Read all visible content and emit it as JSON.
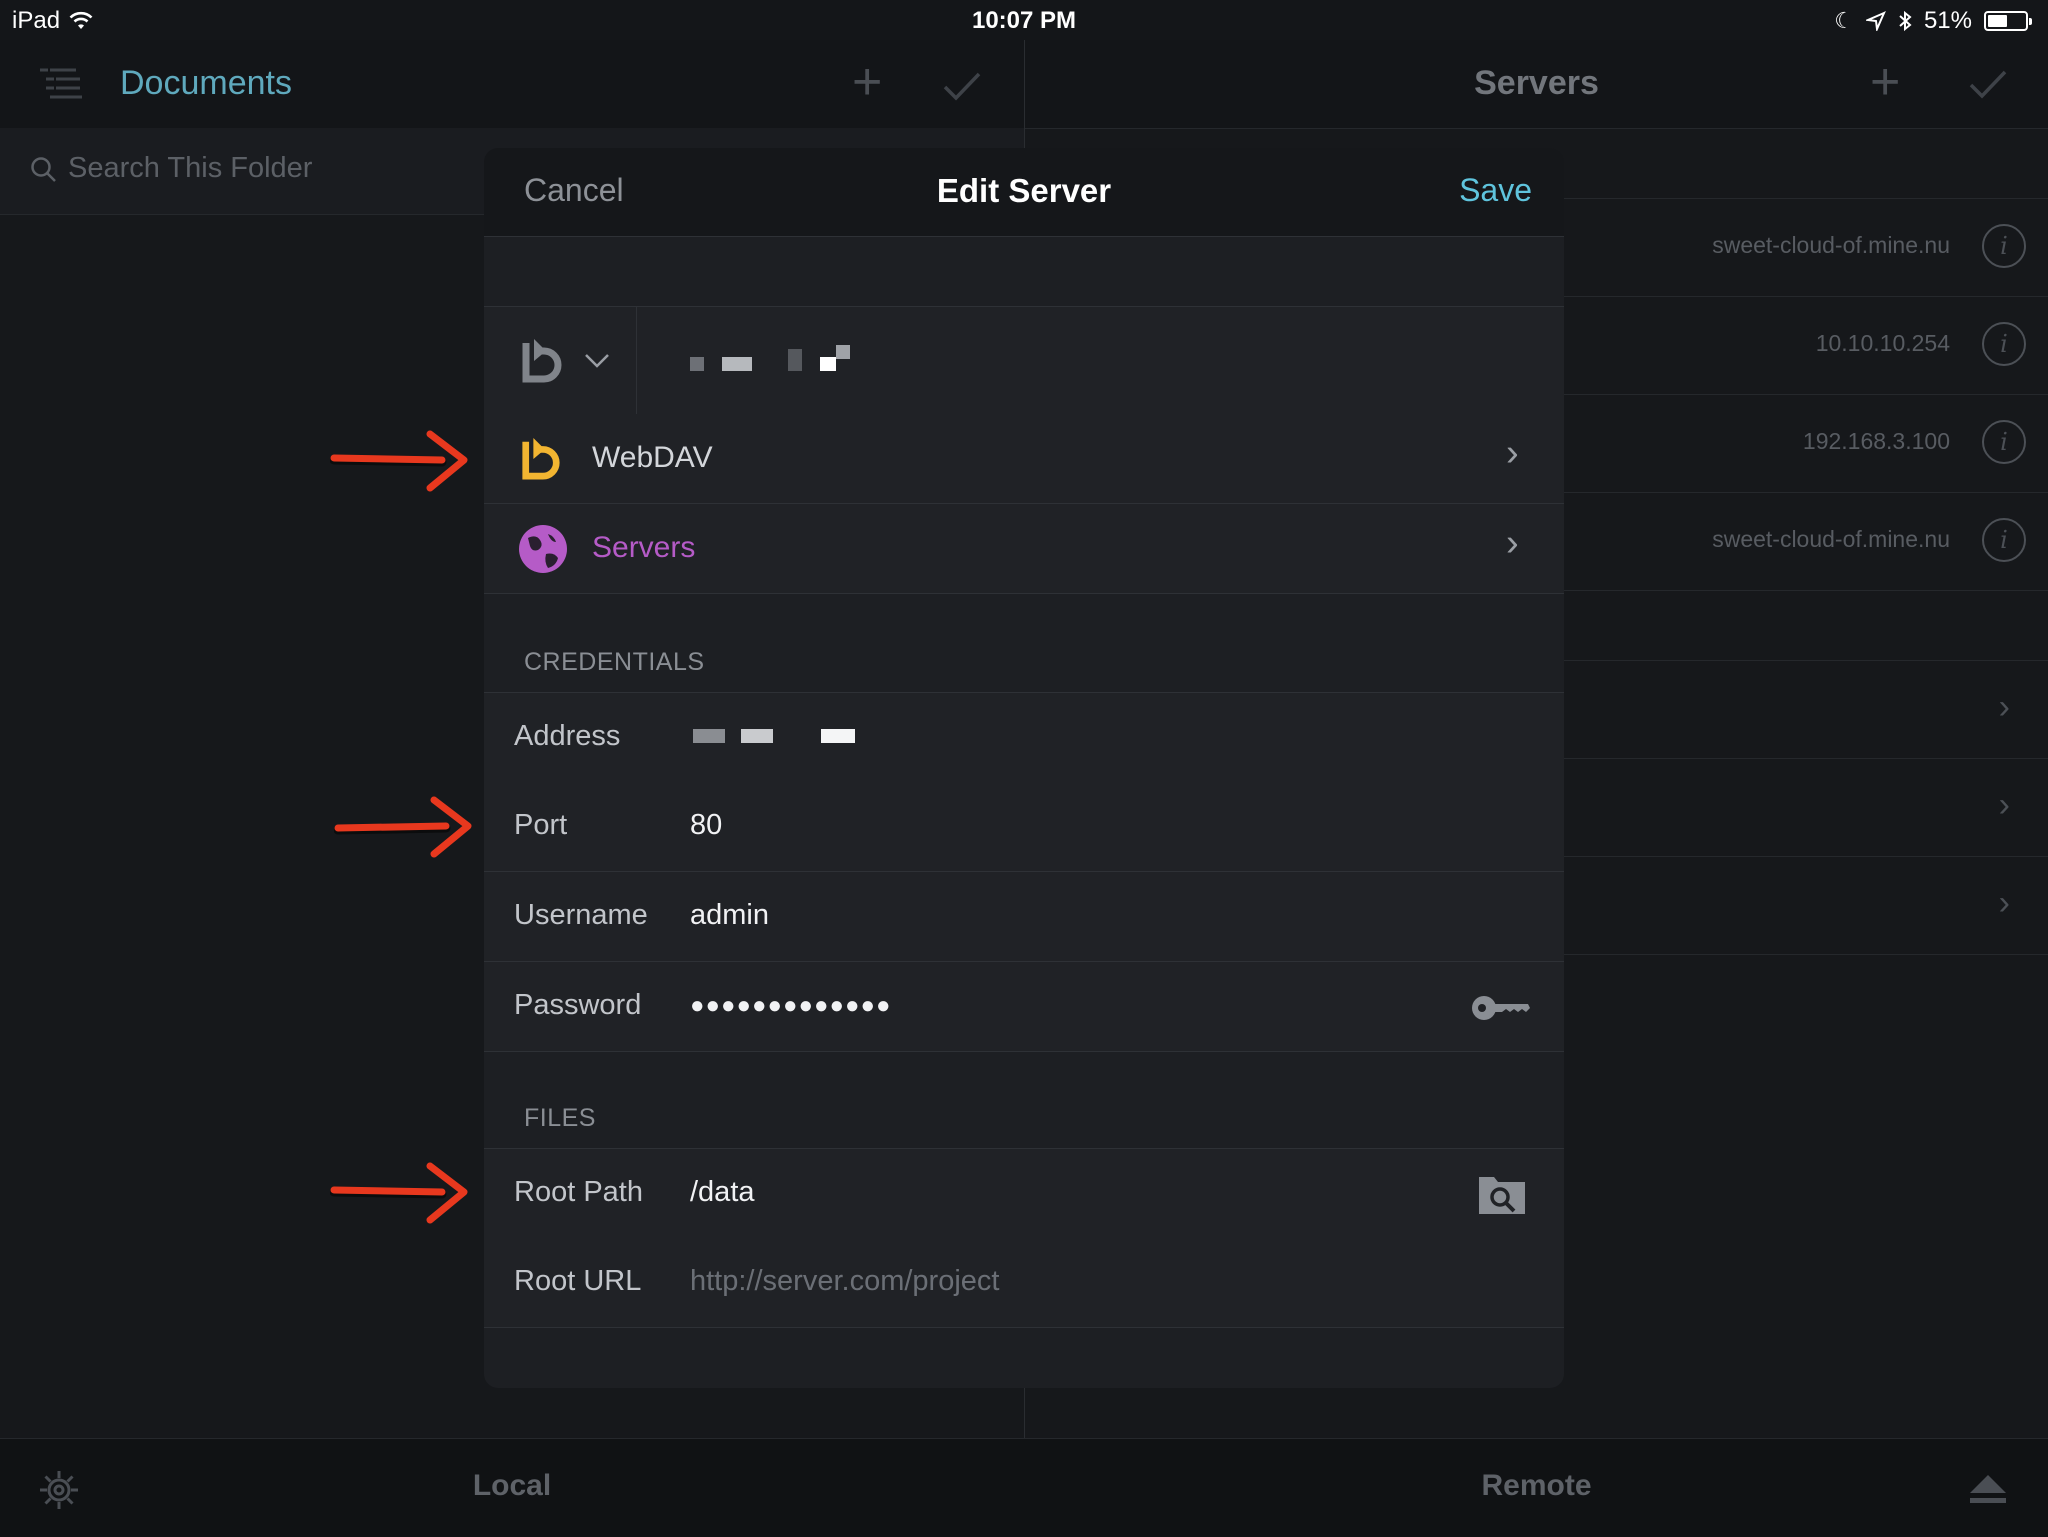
{
  "status_bar": {
    "device": "iPad",
    "time": "10:07 PM",
    "battery": "51%"
  },
  "left_pane": {
    "title": "Documents",
    "search_placeholder": "Search This Folder"
  },
  "right_pane": {
    "title": "Servers",
    "servers": [
      {
        "host": "sweet-cloud-of.mine.nu"
      },
      {
        "host": "10.10.10.254"
      },
      {
        "host": "192.168.3.100"
      },
      {
        "host": "sweet-cloud-of.mine.nu"
      }
    ]
  },
  "tab_bar": {
    "local_label": "Local",
    "remote_label": "Remote"
  },
  "modal": {
    "cancel_label": "Cancel",
    "title": "Edit Server",
    "save_label": "Save",
    "type_row": {
      "label": "WebDAV"
    },
    "group_row": {
      "label": "Servers"
    },
    "credentials_header": "CREDENTIALS",
    "address": {
      "label": "Address"
    },
    "port": {
      "label": "Port",
      "value": "80"
    },
    "username": {
      "label": "Username",
      "value": "admin"
    },
    "password": {
      "label": "Password",
      "value": "●●●●●●●●●●●●●"
    },
    "files_header": "FILES",
    "root_path": {
      "label": "Root Path",
      "value": "/data"
    },
    "root_url": {
      "label": "Root URL",
      "placeholder": "http://server.com/project"
    }
  },
  "colors": {
    "accent": "#5fc4dd",
    "webdav_icon": "#f2b531",
    "servers_purple": "#b55bc7",
    "annotation_arrow": "#e8381e"
  }
}
